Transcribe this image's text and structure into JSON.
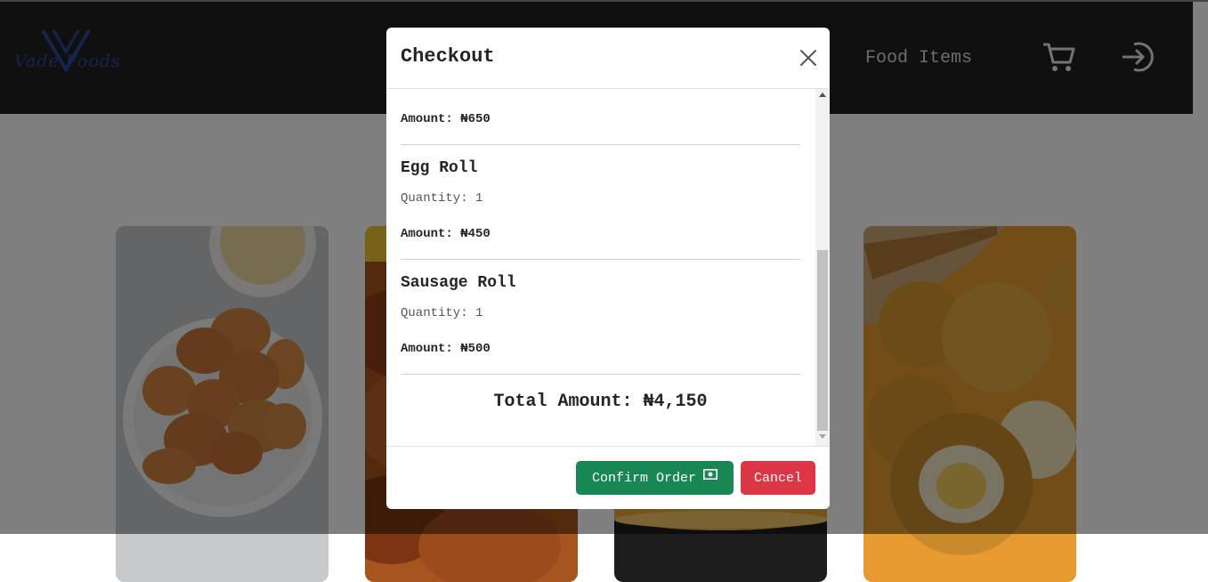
{
  "navbar": {
    "logo_text": "Vade Foods",
    "food_items_label": "Food Items",
    "cart_icon": "cart-icon",
    "signin_icon": "sign-in-icon",
    "background": "#212121",
    "logo_color": "#2c4b9c"
  },
  "modal": {
    "title": "Checkout",
    "close_icon": "close-icon",
    "items": [
      {
        "name": "",
        "quantity_text": "",
        "amount_text": "Amount: ₦650"
      },
      {
        "name": "Egg Roll",
        "quantity_text": "Quantity: 1",
        "amount_text": "Amount: ₦450"
      },
      {
        "name": "Sausage Roll",
        "quantity_text": "Quantity: 1",
        "amount_text": "Amount: ₦500"
      }
    ],
    "total_text": "Total Amount: ₦4,150",
    "confirm_label": "Confirm Order",
    "confirm_icon": "money-icon",
    "cancel_label": "Cancel",
    "confirm_color": "#198754",
    "cancel_color": "#dc3545"
  },
  "food_cards": [
    {
      "image": "puff-puff-image"
    },
    {
      "image": "fried-chicken-image"
    },
    {
      "image": "dark-food-image"
    },
    {
      "image": "scotch-egg-image"
    }
  ]
}
